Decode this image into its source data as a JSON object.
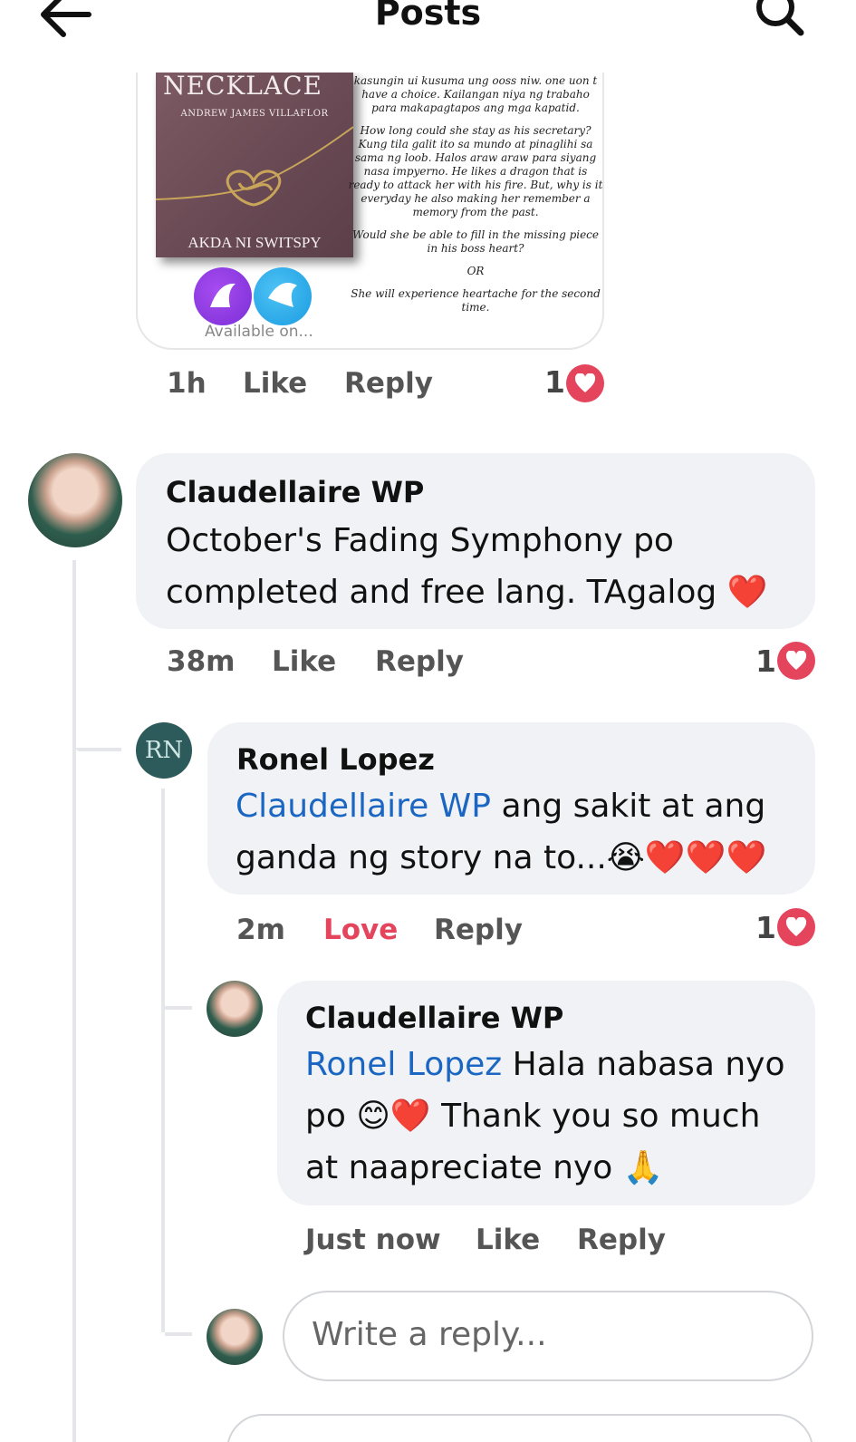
{
  "header": {
    "title": "Posts",
    "back_icon": "arrow-left-icon",
    "search_icon": "search-icon"
  },
  "post_image": {
    "cover_title": "NECKLACE",
    "cover_author": "ANDREW JAMES VILLAFLOR",
    "cover_akda": "AKDA NI SWITSPY",
    "blurb": [
      "kasungin ui kusuma ung ooss niw. one uon t have a choice. Kailangan niya ng trabaho para makapagtapos ang mga kapatid.",
      "How long could she stay as his secretary? Kung tila galit ito sa mundo at pinaglihi sa sama ng loob. Halos araw araw para siyang nasa impyerno. He likes a dragon that is ready to attack her with his fire. But, why is it everyday he also making her remember a memory from the past.",
      "Would she be able to fill in the missing piece in his boss heart?",
      "OR",
      "She will experience heartache for the second time."
    ],
    "available_label": "Available on..."
  },
  "post_actions": {
    "time": "1h",
    "like": "Like",
    "reply": "Reply",
    "reaction_count": "1"
  },
  "comments": [
    {
      "author": "Claudellaire WP",
      "text": "October's Fading Symphony po completed and free lang. TAgalog ❤️",
      "time": "38m",
      "like": "Like",
      "reply": "Reply",
      "reaction_count": "1"
    },
    {
      "author": "Ronel Lopez",
      "avatar_initials": "RN",
      "mention": "Claudellaire WP",
      "text": " ang sakit at ang ganda ng story na to...😭❤️❤️❤️",
      "time": "2m",
      "like": "Love",
      "reply": "Reply",
      "reaction_count": "1"
    },
    {
      "author": "Claudellaire WP",
      "mention": "Ronel Lopez",
      "text": " Hala nabasa nyo po 😊❤️ Thank you so much at naapreciate nyo 🙏",
      "time": "Just now",
      "like": "Like",
      "reply": "Reply"
    }
  ],
  "reply_input": {
    "placeholder": "Write a reply..."
  },
  "colors": {
    "accent": "#1a66c2",
    "love": "#e4445c",
    "bubble": "#f0f2f5"
  }
}
